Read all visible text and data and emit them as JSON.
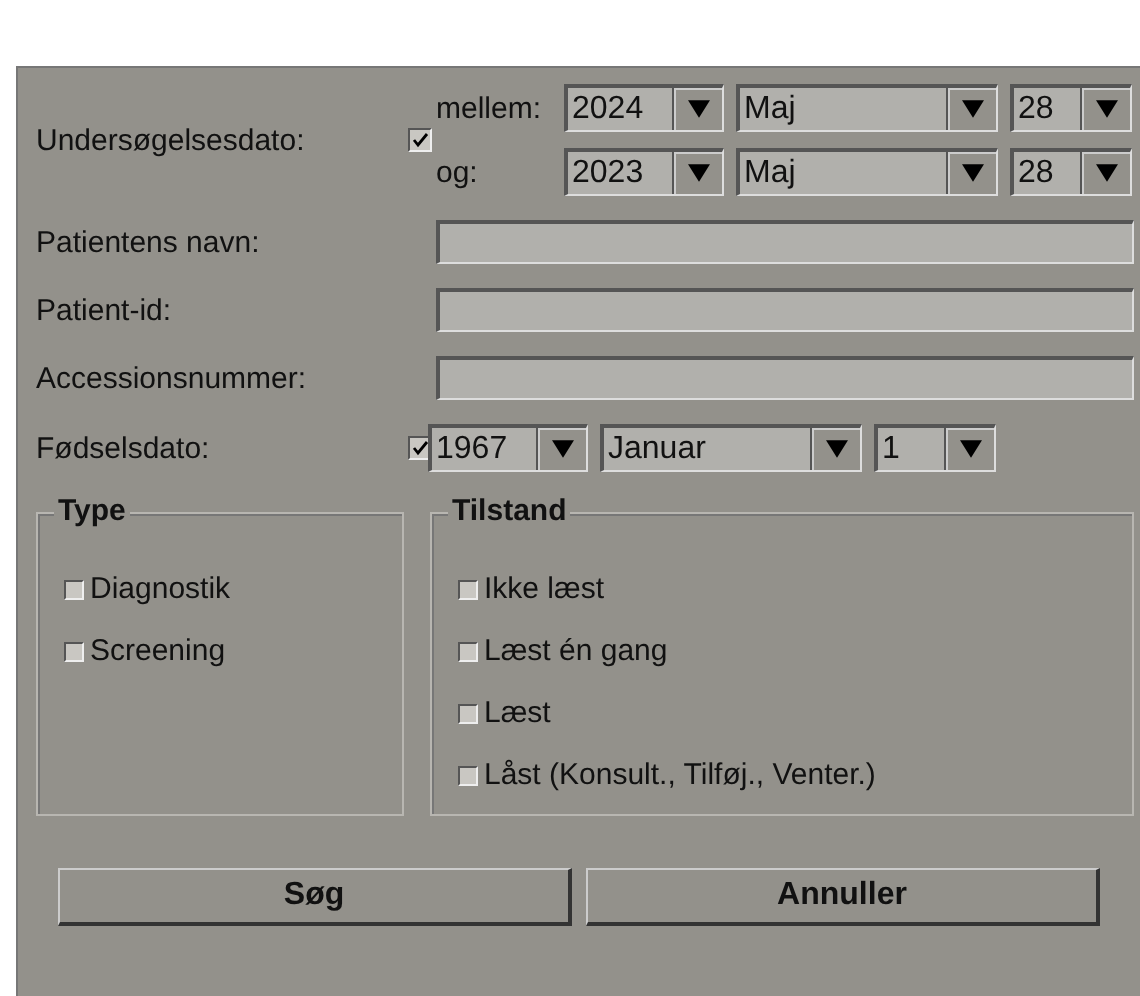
{
  "exam_date": {
    "label": "Undersøgelsesdato:",
    "checked": true,
    "rows": [
      {
        "label": "mellem:",
        "year": "2024",
        "month": "Maj",
        "day": "28"
      },
      {
        "label": "og:",
        "year": "2023",
        "month": "Maj",
        "day": "28"
      }
    ]
  },
  "fields": [
    {
      "label": "Patientens navn:"
    },
    {
      "label": "Patient-id:"
    },
    {
      "label": "Accessionsnummer:"
    }
  ],
  "birth_date": {
    "label": "Fødselsdato:",
    "checked": true,
    "year": "1967",
    "month": "Januar",
    "day": "1"
  },
  "type_group": {
    "title": "Type",
    "options": [
      {
        "label": "Diagnostik",
        "checked": false
      },
      {
        "label": "Screening",
        "checked": false
      }
    ]
  },
  "state_group": {
    "title": "Tilstand",
    "options": [
      {
        "label": "Ikke læst",
        "checked": false
      },
      {
        "label": "Læst én gang",
        "checked": false
      },
      {
        "label": "Læst",
        "checked": false
      },
      {
        "label": "Låst (Konsult., Tilføj., Venter.)",
        "checked": false
      }
    ]
  },
  "buttons": [
    "Søg",
    "Annuller"
  ]
}
